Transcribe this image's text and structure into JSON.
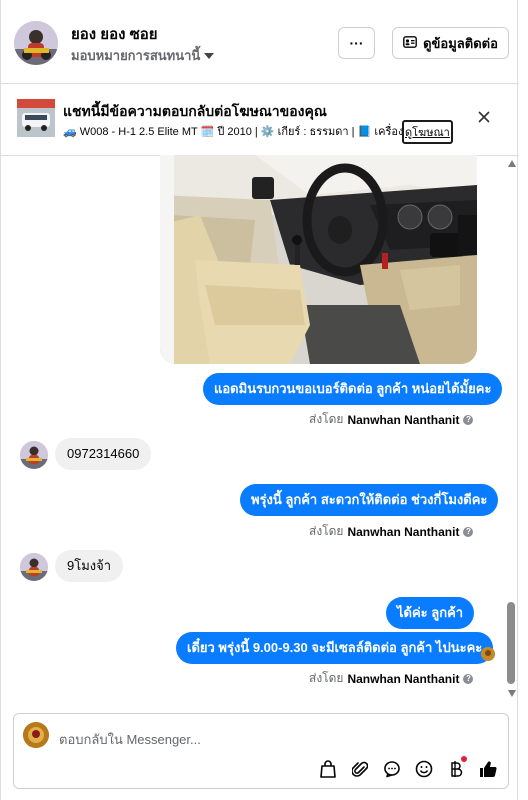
{
  "header": {
    "name": "ยอง ยอง ซอย",
    "assign_label": "มอบหมายการสนทนานี้",
    "more_label": "···",
    "contact_label": "ดูข้อมูลติดต่อ"
  },
  "ad": {
    "title": "แชทนี้มีข้อความตอบกลับต่อโฆษณาของคุณ",
    "desc": "🚙 W008 - H-1 2.5 Elite MT 🗓️ ปี 2010 | ⚙️ เกียร์ : ธรรมดา | 📘 เครื่อง...",
    "link_label": "ดูโฆษณา"
  },
  "messages": [
    {
      "type": "out",
      "text": "แอดมินรบกวนขอเบอร์ติดต่อ ลูกค้า หน่อยได้มั้ยคะ"
    },
    {
      "type": "sent",
      "prefix": "ส่งโดย",
      "sender": "Nanwhan Nanthanit"
    },
    {
      "type": "in",
      "text": "0972314660"
    },
    {
      "type": "out",
      "text": "พรุ่งนี้ ลูกค้า สะดวกให้ติดต่อ ช่วงกี่โมงดีคะ"
    },
    {
      "type": "sent",
      "prefix": "ส่งโดย",
      "sender": "Nanwhan Nanthanit"
    },
    {
      "type": "in",
      "text": "9โมงจ้า"
    },
    {
      "type": "out",
      "text": "ได้ค่ะ  ลูกค้า"
    },
    {
      "type": "out",
      "text": "เดี๋ยว พรุ่งนี้ 9.00-9.30 จะมีเซลล์ติดต่อ ลูกค้า ไปนะคะ"
    },
    {
      "type": "sent",
      "prefix": "ส่งโดย",
      "sender": "Nanwhan Nanthanit"
    }
  ],
  "composer": {
    "placeholder": "ตอบกลับใน Messenger..."
  },
  "icons": [
    "chevron-down-icon",
    "contact-card-icon",
    "close-icon",
    "info-icon",
    "shopping-bag-icon",
    "attachment-icon",
    "chat-icon",
    "emoji-icon",
    "baht-icon",
    "like-icon"
  ]
}
